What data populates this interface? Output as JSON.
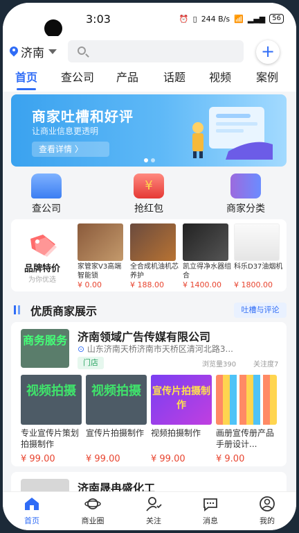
{
  "status_bar": {
    "time": "3:03",
    "network": "244 B/s",
    "battery": "56"
  },
  "header": {
    "city": "济南",
    "search_placeholder": ""
  },
  "tabs": [
    {
      "label": "首页",
      "active": true
    },
    {
      "label": "查公司"
    },
    {
      "label": "产品"
    },
    {
      "label": "话题"
    },
    {
      "label": "视频"
    },
    {
      "label": "案例"
    }
  ],
  "banner": {
    "title": "商家吐槽和好评",
    "subtitle": "让商业信息更透明",
    "button": "查看详情 〉"
  },
  "quick": [
    {
      "label": "查公司"
    },
    {
      "label": "抢红包"
    },
    {
      "label": "商家分类"
    }
  ],
  "promo": {
    "brand_label": "品牌特价",
    "brand_sub": "为你优选",
    "items": [
      {
        "name": "家管家V3高端智能锁",
        "price": "¥ 0.00"
      },
      {
        "name": "全合成机油机芯养护",
        "price": "¥ 188.00"
      },
      {
        "name": "凯立得净水器组合",
        "price": "¥ 1400.00"
      },
      {
        "name": "科乐D37油烟机",
        "price": "¥ 1800.00"
      }
    ]
  },
  "section": {
    "title": "优质商家展示",
    "review_button": "吐槽与评论"
  },
  "merchant": {
    "logo_text": "商务服务",
    "name": "济南领域广告传媒有限公司",
    "address": "山东济南天桥济南市天桥区清河北路3...",
    "tag": "门店",
    "views": "浏览量390",
    "follows": "关注度7",
    "services": [
      {
        "img_text": "视频拍摄",
        "name": "专业宣传片策划拍摄制作",
        "price": "¥ 99.00"
      },
      {
        "img_text": "视频拍摄",
        "name": "宣传片拍摄制作",
        "price": "¥ 99.00"
      },
      {
        "img_text": "宣传片拍摄制作",
        "name": "视频拍摄制作",
        "price": "¥ 99.00"
      },
      {
        "img_text": "",
        "name": "画册宣传册产品手册设计...",
        "price": "¥ 9.00"
      }
    ]
  },
  "merchant2": {
    "name": "济南晟冉盛化工"
  },
  "nav": [
    {
      "label": "首页",
      "active": true
    },
    {
      "label": "商业圈"
    },
    {
      "label": "关注"
    },
    {
      "label": "消息"
    },
    {
      "label": "我的"
    }
  ],
  "colors": {
    "accent": "#2f6cf6",
    "price": "#e8442f",
    "tag_green": "#2aa562"
  }
}
